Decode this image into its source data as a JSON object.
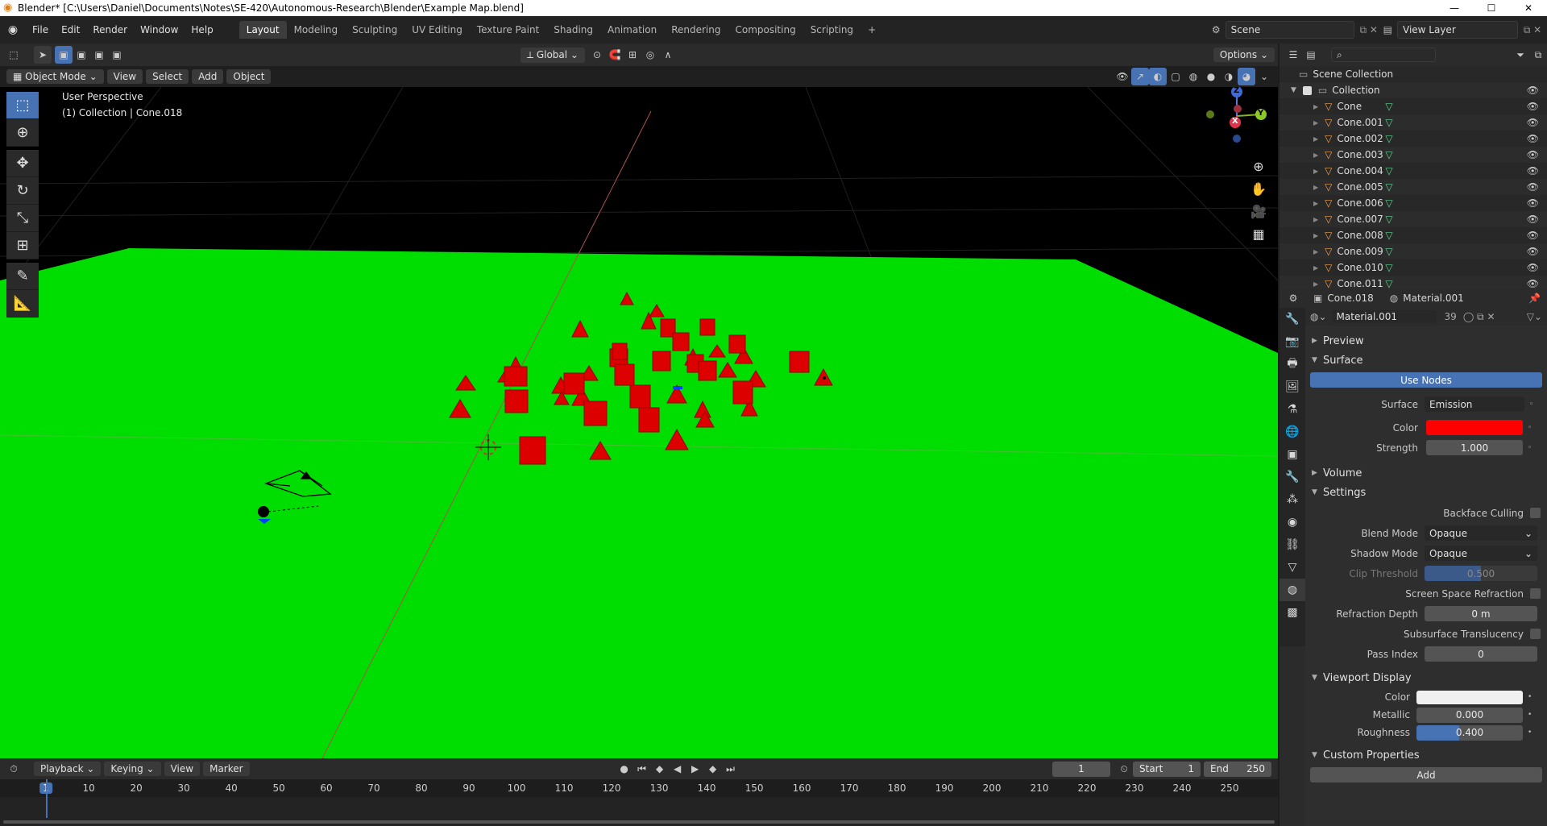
{
  "window": {
    "title": "Blender* [C:\\Users\\Daniel\\Documents\\Notes\\SE-420\\Autonomous-Research\\Blender\\Example Map.blend]",
    "minimize": "—",
    "maximize": "☐",
    "close": "✕"
  },
  "menu": [
    "File",
    "Edit",
    "Render",
    "Window",
    "Help"
  ],
  "workspaces": [
    "Layout",
    "Modeling",
    "Sculpting",
    "UV Editing",
    "Texture Paint",
    "Shading",
    "Animation",
    "Rendering",
    "Compositing",
    "Scripting"
  ],
  "active_workspace": "Layout",
  "scene": {
    "name": "Scene",
    "view_layer": "View Layer"
  },
  "header": {
    "orientation": "Global",
    "options": "Options"
  },
  "viewport_header": {
    "mode": "Object Mode",
    "view": "View",
    "select": "Select",
    "add": "Add",
    "object": "Object"
  },
  "viewport": {
    "perspective": "User Perspective",
    "info": "(1) Collection | Cone.018",
    "axes": {
      "x": "X",
      "y": "Y",
      "z": "Z"
    }
  },
  "colors": {
    "ground": "#00dd00",
    "cones": "#dd0000",
    "accent": "#4772b3",
    "emission_color": "#ff0000"
  },
  "outliner": {
    "root": "Scene Collection",
    "collection": "Collection",
    "items": [
      "Cone",
      "Cone.001",
      "Cone.002",
      "Cone.003",
      "Cone.004",
      "Cone.005",
      "Cone.006",
      "Cone.007",
      "Cone.008",
      "Cone.009",
      "Cone.010",
      "Cone.011"
    ]
  },
  "properties": {
    "object": "Cone.018",
    "material": "Material.001",
    "slot_material": "Material.001",
    "users": "39",
    "sections": {
      "preview": "Preview",
      "surface": "Surface",
      "volume": "Volume",
      "settings": "Settings",
      "viewport_display": "Viewport Display",
      "custom_properties": "Custom Properties"
    },
    "use_nodes": "Use Nodes",
    "surface": {
      "surface_label": "Surface",
      "surface_value": "Emission",
      "color_label": "Color",
      "strength_label": "Strength",
      "strength_value": "1.000"
    },
    "settings": {
      "backface_culling": "Backface Culling",
      "blend_mode_label": "Blend Mode",
      "blend_mode": "Opaque",
      "shadow_mode_label": "Shadow Mode",
      "shadow_mode": "Opaque",
      "clip_threshold_label": "Clip Threshold",
      "clip_threshold": "0.500",
      "ssr": "Screen Space Refraction",
      "refraction_depth_label": "Refraction Depth",
      "refraction_depth": "0 m",
      "subsurface": "Subsurface Translucency",
      "pass_index_label": "Pass Index",
      "pass_index": "0"
    },
    "viewport_display": {
      "color_label": "Color",
      "metallic_label": "Metallic",
      "metallic": "0.000",
      "roughness_label": "Roughness",
      "roughness": "0.400",
      "roughness_fraction": 0.4
    },
    "add": "Add"
  },
  "timeline": {
    "playback": "Playback",
    "keying": "Keying",
    "view": "View",
    "marker": "Marker",
    "current_frame": "1",
    "start_label": "Start",
    "start": "1",
    "end_label": "End",
    "end": "250",
    "ticks": [
      "1",
      "10",
      "20",
      "30",
      "40",
      "50",
      "60",
      "70",
      "80",
      "90",
      "100",
      "110",
      "120",
      "130",
      "140",
      "150",
      "160",
      "170",
      "180",
      "190",
      "200",
      "210",
      "220",
      "230",
      "240",
      "250"
    ]
  }
}
